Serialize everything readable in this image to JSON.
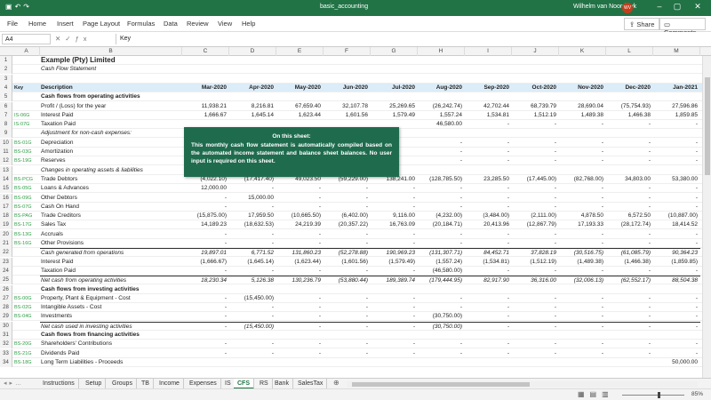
{
  "titlebar": {
    "document": "basic_accounting",
    "user": "Wilhelm van Noordwyk",
    "initials": "WV"
  },
  "menu": [
    "File",
    "Home",
    "Insert",
    "Page Layout",
    "Formulas",
    "Data",
    "Review",
    "View",
    "Help"
  ],
  "share_label": "Share",
  "comments_label": "Comments",
  "namebox": "A4",
  "formula": "Key",
  "columns": [
    "A",
    "B",
    "C",
    "D",
    "E",
    "F",
    "G",
    "H",
    "I",
    "J",
    "K",
    "L",
    "M"
  ],
  "months": [
    "Mar-2020",
    "Apr-2020",
    "May-2020",
    "Jun-2020",
    "Jul-2020",
    "Aug-2020",
    "Sep-2020",
    "Oct-2020",
    "Nov-2020",
    "Dec-2020",
    "Jan-2021"
  ],
  "rows": [
    {
      "n": "1",
      "a": "",
      "b": "Example (Pty) Limited",
      "style": "bold",
      "v": []
    },
    {
      "n": "2",
      "a": "",
      "b": "Cash Flow Statement",
      "style": "ital",
      "v": []
    },
    {
      "n": "3",
      "a": "",
      "b": "",
      "style": "",
      "v": []
    },
    {
      "n": "4",
      "a": "Key",
      "b": "Description",
      "style": "hdr",
      "v": []
    },
    {
      "n": "5",
      "a": "",
      "b": "Cash flows from operating activities",
      "style": "bold",
      "v": []
    },
    {
      "n": "6",
      "a": "",
      "b": "Profit / (Loss) for the year",
      "style": "",
      "v": [
        "11,938.21",
        "8,216.81",
        "67,659.40",
        "32,107.78",
        "25,269.65",
        "(26,242.74)",
        "42,702.44",
        "68,739.79",
        "28,690.04",
        "(75,754.93)",
        "27,596.86"
      ]
    },
    {
      "n": "7",
      "a": "IS-06G",
      "b": "Interest Paid",
      "style": "",
      "v": [
        "1,666.67",
        "1,645.14",
        "1,623.44",
        "1,601.56",
        "1,579.49",
        "1,557.24",
        "1,534.81",
        "1,512.19",
        "1,489.38",
        "1,466.38",
        "1,859.85"
      ]
    },
    {
      "n": "8",
      "a": "IS-07G",
      "b": "Taxation Paid",
      "style": "",
      "v": [
        "",
        "",
        "",
        "",
        "",
        "46,580.00",
        "-",
        "-",
        "-",
        "-",
        "-"
      ]
    },
    {
      "n": "9",
      "a": "",
      "b": "Adjustment for non-cash expenses:",
      "style": "ital",
      "v": []
    },
    {
      "n": "10",
      "a": "BS-01G",
      "b": "Depreciation",
      "style": "",
      "v": [
        "",
        "",
        "",
        "",
        "",
        "-",
        "-",
        "-",
        "-",
        "-",
        "-"
      ]
    },
    {
      "n": "11",
      "a": "BS-03G",
      "b": "Amortization",
      "style": "",
      "v": [
        "",
        "",
        "",
        "",
        "",
        "-",
        "-",
        "-",
        "-",
        "-",
        "-"
      ]
    },
    {
      "n": "12",
      "a": "BS-19G",
      "b": "Reserves",
      "style": "",
      "v": [
        "",
        "",
        "",
        "",
        "",
        "-",
        "-",
        "-",
        "-",
        "-",
        "-"
      ]
    },
    {
      "n": "13",
      "a": "",
      "b": "Changes in operating assets & liabilities",
      "style": "ital",
      "v": []
    },
    {
      "n": "14",
      "a": "BS-PCG",
      "b": "Trade Debtors",
      "style": "",
      "v": [
        "(4,022.10)",
        "(17,417.40)",
        "49,023.50",
        "(59,229.00)",
        "138,241.00",
        "(128,785.50)",
        "23,285.50",
        "(17,445.00)",
        "(82,768.00)",
        "34,803.00",
        "53,380.00"
      ]
    },
    {
      "n": "15",
      "a": "BS-05G",
      "b": "Loans & Advances",
      "style": "",
      "v": [
        "12,000.00",
        "-",
        "-",
        "-",
        "-",
        "-",
        "-",
        "-",
        "-",
        "-",
        "-"
      ]
    },
    {
      "n": "16",
      "a": "BS-09G",
      "b": "Other Debtors",
      "style": "",
      "v": [
        "-",
        "15,000.00",
        "-",
        "-",
        "-",
        "-",
        "-",
        "-",
        "-",
        "-",
        "-"
      ]
    },
    {
      "n": "17",
      "a": "BS-07G",
      "b": "Cash On Hand",
      "style": "",
      "v": [
        "-",
        "-",
        "-",
        "-",
        "-",
        "-",
        "-",
        "-",
        "-",
        "-",
        "-"
      ]
    },
    {
      "n": "18",
      "a": "BS-PAG",
      "b": "Trade Creditors",
      "style": "",
      "v": [
        "(15,875.00)",
        "17,959.50",
        "(10,665.50)",
        "(6,402.00)",
        "9,116.00",
        "(4,232.00)",
        "(3,484.00)",
        "(2,111.00)",
        "4,878.50",
        "6,572.50",
        "(10,887.00)"
      ]
    },
    {
      "n": "19",
      "a": "BS-17G",
      "b": "Sales Tax",
      "style": "",
      "v": [
        "14,189.23",
        "(18,632.53)",
        "24,219.39",
        "(20,357.22)",
        "16,763.09",
        "(20,184.71)",
        "20,413.96",
        "(12,867.79)",
        "17,193.33",
        "(28,172.74)",
        "18,414.52"
      ]
    },
    {
      "n": "20",
      "a": "BS-13G",
      "b": "Accruals",
      "style": "",
      "v": [
        "-",
        "-",
        "-",
        "-",
        "-",
        "-",
        "-",
        "-",
        "-",
        "-",
        "-"
      ]
    },
    {
      "n": "21",
      "a": "BS-16G",
      "b": "Other Provisions",
      "style": "",
      "v": [
        "-",
        "-",
        "-",
        "-",
        "-",
        "-",
        "-",
        "-",
        "-",
        "-",
        "-"
      ]
    },
    {
      "n": "22",
      "a": "",
      "b": "Cash generated from operations",
      "style": "ital topline",
      "v": [
        "19,897.01",
        "6,771.52",
        "131,860.23",
        "(52,278.88)",
        "190,969.23",
        "(131,307.71)",
        "84,452.71",
        "37,828.19",
        "(30,516.75)",
        "(61,085.79)",
        "90,364.23"
      ]
    },
    {
      "n": "23",
      "a": "",
      "b": "Interest Paid",
      "style": "",
      "v": [
        "(1,666.67)",
        "(1,645.14)",
        "(1,623.44)",
        "(1,601.56)",
        "(1,579.49)",
        "(1,557.24)",
        "(1,534.81)",
        "(1,512.19)",
        "(1,489.38)",
        "(1,466.38)",
        "(1,859.85)"
      ]
    },
    {
      "n": "24",
      "a": "",
      "b": "Taxation Paid",
      "style": "",
      "v": [
        "-",
        "-",
        "-",
        "-",
        "-",
        "(46,580.00)",
        "-",
        "-",
        "-",
        "-",
        "-"
      ]
    },
    {
      "n": "25",
      "a": "",
      "b": "Net cash from operating activities",
      "style": "ital topline",
      "v": [
        "18,230.34",
        "5,126.38",
        "130,236.79",
        "(53,880.44)",
        "189,389.74",
        "(179,444.95)",
        "82,917.90",
        "36,316.00",
        "(32,006.13)",
        "(62,552.17)",
        "88,504.38"
      ]
    },
    {
      "n": "26",
      "a": "",
      "b": "Cash flows from investing activities",
      "style": "bold",
      "v": []
    },
    {
      "n": "27",
      "a": "BS-00G",
      "b": "Property, Plant & Equipment - Cost",
      "style": "",
      "v": [
        "-",
        "(15,450.00)",
        "-",
        "-",
        "-",
        "-",
        "-",
        "-",
        "-",
        "-",
        "-"
      ]
    },
    {
      "n": "28",
      "a": "BS-02G",
      "b": "Intangible Assets - Cost",
      "style": "",
      "v": [
        "-",
        "-",
        "-",
        "-",
        "-",
        "-",
        "-",
        "-",
        "-",
        "-",
        "-"
      ]
    },
    {
      "n": "29",
      "a": "BS-04G",
      "b": "Investments",
      "style": "",
      "v": [
        "-",
        "-",
        "-",
        "-",
        "-",
        "(30,750.00)",
        "-",
        "-",
        "-",
        "-",
        "-"
      ]
    },
    {
      "n": "30",
      "a": "",
      "b": "Net cash used in investing activities",
      "style": "ital topline",
      "v": [
        "-",
        "(15,450.00)",
        "-",
        "-",
        "-",
        "(30,750.00)",
        "-",
        "-",
        "-",
        "-",
        "-"
      ]
    },
    {
      "n": "31",
      "a": "",
      "b": "Cash flows from financing activities",
      "style": "bold",
      "v": []
    },
    {
      "n": "32",
      "a": "BS-20G",
      "b": "Shareholders' Contributions",
      "style": "",
      "v": [
        "-",
        "-",
        "-",
        "-",
        "-",
        "-",
        "-",
        "-",
        "-",
        "-",
        "-"
      ]
    },
    {
      "n": "33",
      "a": "BS-21G",
      "b": "Dividends Paid",
      "style": "",
      "v": [
        "-",
        "-",
        "-",
        "-",
        "-",
        "-",
        "-",
        "-",
        "-",
        "-",
        "-"
      ]
    },
    {
      "n": "34",
      "a": "BS-18G",
      "b": "Long Term Liabilities - Proceeds",
      "style": "",
      "v": [
        "",
        "",
        "",
        "",
        "",
        "",
        "",
        "",
        "",
        "",
        "50,000.00"
      ]
    }
  ],
  "callout": {
    "heading": "On this sheet:",
    "text": "This monthly cash flow statement is automatically compiled based on the automated income statement and balance sheet balances. No user input is required on this sheet."
  },
  "tabs": [
    "Instructions",
    "Setup",
    "Groups",
    "TB",
    "Income",
    "Expenses",
    "IS",
    "CFS",
    "RS",
    "Bank",
    "SalesTax"
  ],
  "active_tab": "CFS",
  "zoom": "85%",
  "colors": {
    "accent": "#217346",
    "key_text": "#2e9e46",
    "callout_bg": "#1f6b4e",
    "header_row": "#dcecf8"
  },
  "icons": [
    "undo-icon",
    "redo-icon",
    "save-icon",
    "minimize-icon",
    "maximize-icon",
    "close-icon",
    "share-icon",
    "comment-icon"
  ]
}
